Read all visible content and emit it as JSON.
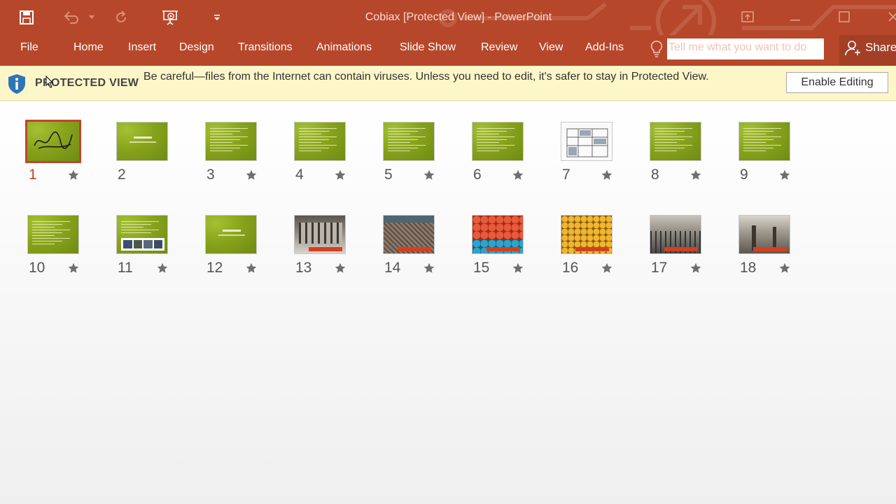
{
  "window": {
    "title": "Cobiax [Protected View] - PowerPoint",
    "accent_color": "#b7472a"
  },
  "quick_access": {
    "icons": [
      "save-icon",
      "undo-icon",
      "undo-dropdown-icon",
      "redo-icon",
      "present-from-start-icon",
      "customize-dropdown-icon"
    ]
  },
  "window_controls": [
    "ribbon-display-options-icon",
    "minimize-icon",
    "maximize-icon",
    "close-icon"
  ],
  "ribbon": {
    "tabs": [
      "File",
      "Home",
      "Insert",
      "Design",
      "Transitions",
      "Animations",
      "Slide Show",
      "Review",
      "View",
      "Add-Ins"
    ],
    "tell_me_placeholder": "Tell me what you want to do",
    "share_label": "Share"
  },
  "protected_view": {
    "title": "PROTECTED VIEW",
    "message": "Be careful—files from the Internet can contain viruses. Unless you need to edit, it's safer to stay in Protected View.",
    "button": "Enable Editing"
  },
  "slides": [
    {
      "number": "1",
      "style": "calligraphy",
      "selected": true,
      "has_transition": true
    },
    {
      "number": "2",
      "style": "title",
      "selected": false,
      "has_transition": false
    },
    {
      "number": "3",
      "style": "text",
      "selected": false,
      "has_transition": true
    },
    {
      "number": "4",
      "style": "text",
      "selected": false,
      "has_transition": true
    },
    {
      "number": "5",
      "style": "text",
      "selected": false,
      "has_transition": true
    },
    {
      "number": "6",
      "style": "text",
      "selected": false,
      "has_transition": true
    },
    {
      "number": "7",
      "style": "drawing",
      "selected": false,
      "has_transition": true
    },
    {
      "number": "8",
      "style": "text",
      "selected": false,
      "has_transition": true
    },
    {
      "number": "9",
      "style": "text",
      "selected": false,
      "has_transition": true
    },
    {
      "number": "10",
      "style": "text",
      "selected": false,
      "has_transition": true
    },
    {
      "number": "11",
      "style": "text-images",
      "selected": false,
      "has_transition": true
    },
    {
      "number": "12",
      "style": "title",
      "selected": false,
      "has_transition": true
    },
    {
      "number": "13",
      "style": "photo-gray",
      "selected": false,
      "has_transition": true
    },
    {
      "number": "14",
      "style": "photo-rebar",
      "selected": false,
      "has_transition": true
    },
    {
      "number": "15",
      "style": "photo-red-blue",
      "selected": false,
      "has_transition": true
    },
    {
      "number": "16",
      "style": "photo-yellow",
      "selected": false,
      "has_transition": true
    },
    {
      "number": "17",
      "style": "photo-site",
      "selected": false,
      "has_transition": true
    },
    {
      "number": "18",
      "style": "photo-interior",
      "selected": false,
      "has_transition": true
    }
  ]
}
